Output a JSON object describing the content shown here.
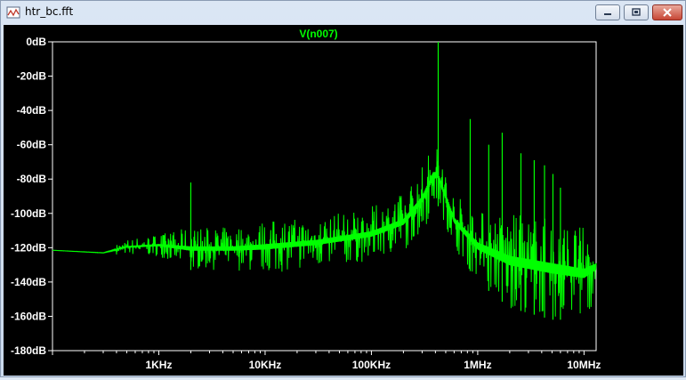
{
  "window": {
    "title": "htr_bc.fft",
    "icon": "waveform-file-icon",
    "buttons": [
      "minimize",
      "restore",
      "close"
    ]
  },
  "colors": {
    "trace": "#00ff00",
    "plot_background": "#000000",
    "axis_text": "#ffffff"
  },
  "chart_data": {
    "type": "line",
    "title": "V(n007)",
    "x_scale": "log",
    "xlim": [
      100,
      13000000
    ],
    "ylim": [
      -180,
      0
    ],
    "xticks": [
      {
        "value": 1000,
        "label": "1KHz"
      },
      {
        "value": 10000,
        "label": "10KHz"
      },
      {
        "value": 100000,
        "label": "100KHz"
      },
      {
        "value": 1000000,
        "label": "1MHz"
      },
      {
        "value": 10000000,
        "label": "10MHz"
      }
    ],
    "yticks": [
      {
        "value": 0,
        "label": "0dB"
      },
      {
        "value": -20,
        "label": "-20dB"
      },
      {
        "value": -40,
        "label": "-40dB"
      },
      {
        "value": -60,
        "label": "-60dB"
      },
      {
        "value": -80,
        "label": "-80dB"
      },
      {
        "value": -100,
        "label": "-100dB"
      },
      {
        "value": -120,
        "label": "-120dB"
      },
      {
        "value": -140,
        "label": "-140dB"
      },
      {
        "value": -160,
        "label": "-160dB"
      },
      {
        "value": -180,
        "label": "-180dB"
      }
    ],
    "series": [
      {
        "envelope": [
          {
            "f": 100,
            "hi": -121,
            "lo": -122
          },
          {
            "f": 300,
            "hi": -122,
            "lo": -124
          },
          {
            "f": 500,
            "hi": -115,
            "lo": -124
          },
          {
            "f": 1000,
            "hi": -112,
            "lo": -125
          },
          {
            "f": 2000,
            "hi": -108,
            "lo": -133
          },
          {
            "f": 5000,
            "hi": -108,
            "lo": -133
          },
          {
            "f": 10000,
            "hi": -104,
            "lo": -135
          },
          {
            "f": 30000,
            "hi": -102,
            "lo": -132
          },
          {
            "f": 100000,
            "hi": -96,
            "lo": -128
          },
          {
            "f": 200000,
            "hi": -88,
            "lo": -122
          },
          {
            "f": 300000,
            "hi": -72,
            "lo": -112
          },
          {
            "f": 380000,
            "hi": -58,
            "lo": -98
          },
          {
            "f": 420000,
            "hi": -60,
            "lo": -95
          },
          {
            "f": 600000,
            "hi": -88,
            "lo": -120
          },
          {
            "f": 1000000,
            "hi": -98,
            "lo": -140
          },
          {
            "f": 2000000,
            "hi": -100,
            "lo": -155
          },
          {
            "f": 5000000,
            "hi": -102,
            "lo": -162
          },
          {
            "f": 10000000,
            "hi": -108,
            "lo": -162
          },
          {
            "f": 13000000,
            "hi": -112,
            "lo": -150
          }
        ],
        "spikes": [
          {
            "f": 2000,
            "db": -82
          },
          {
            "f": 425000,
            "db": 0
          },
          {
            "f": 850000,
            "db": -45
          },
          {
            "f": 1270000,
            "db": -60
          },
          {
            "f": 1700000,
            "db": -53
          },
          {
            "f": 2550000,
            "db": -65
          },
          {
            "f": 3400000,
            "db": -69
          },
          {
            "f": 4250000,
            "db": -72
          },
          {
            "f": 5100000,
            "db": -77
          },
          {
            "f": 6000000,
            "db": -85
          }
        ]
      }
    ]
  }
}
